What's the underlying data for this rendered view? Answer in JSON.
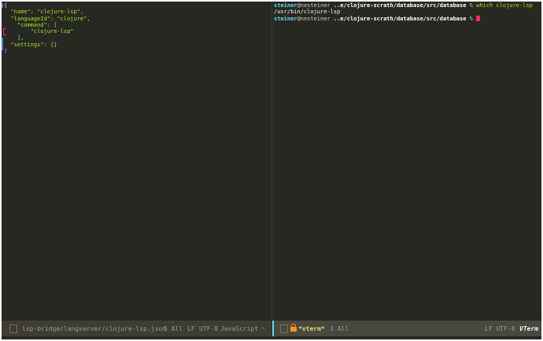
{
  "editor": {
    "lines": [
      {
        "text": "{"
      },
      {
        "text": "  \"name\": \"clojure-lsp\","
      },
      {
        "text": "  \"languageId\": \"clojure\","
      },
      {
        "text": "    \"command\": ["
      },
      {
        "text": "        \"clojure-lsp\""
      },
      {
        "text": "    ],"
      },
      {
        "text": "  \"settings\": {}"
      },
      {
        "text": "}"
      }
    ]
  },
  "terminal": {
    "lines": [
      {
        "user": "steiner",
        "host": "@nesteiner ",
        "path": "..e/clojure-scrath/database/src/database",
        "pct": " % ",
        "cmd": "which clojure-lsp"
      },
      {
        "output": "/usr/bin/clojure-lsp"
      },
      {
        "user": "steiner",
        "host": "@nesteiner ",
        "path": "..e/clojure-scrath/database/src/database",
        "pct": " % ",
        "cmd": ""
      }
    ]
  },
  "modeline_left": {
    "file": "lsp-bridge/langserver/clojure-lsp.json",
    "line_info": "5 All",
    "eol": "LF",
    "encoding": "UTF-8",
    "mode": "JavaScript",
    "edit_icon": "✎"
  },
  "modeline_right": {
    "buffer": "*vterm*",
    "line_info": "3 All",
    "eol_enc": "LF UTF-8",
    "mode": "VTerm"
  },
  "icons": {
    "file": "file-icon",
    "terminal": "terminal-icon",
    "lock": "lock-icon"
  },
  "colors": {
    "background": "#272822",
    "string": "#a6e22e",
    "accent": "#66d9ef",
    "cursor": "#f92672"
  }
}
